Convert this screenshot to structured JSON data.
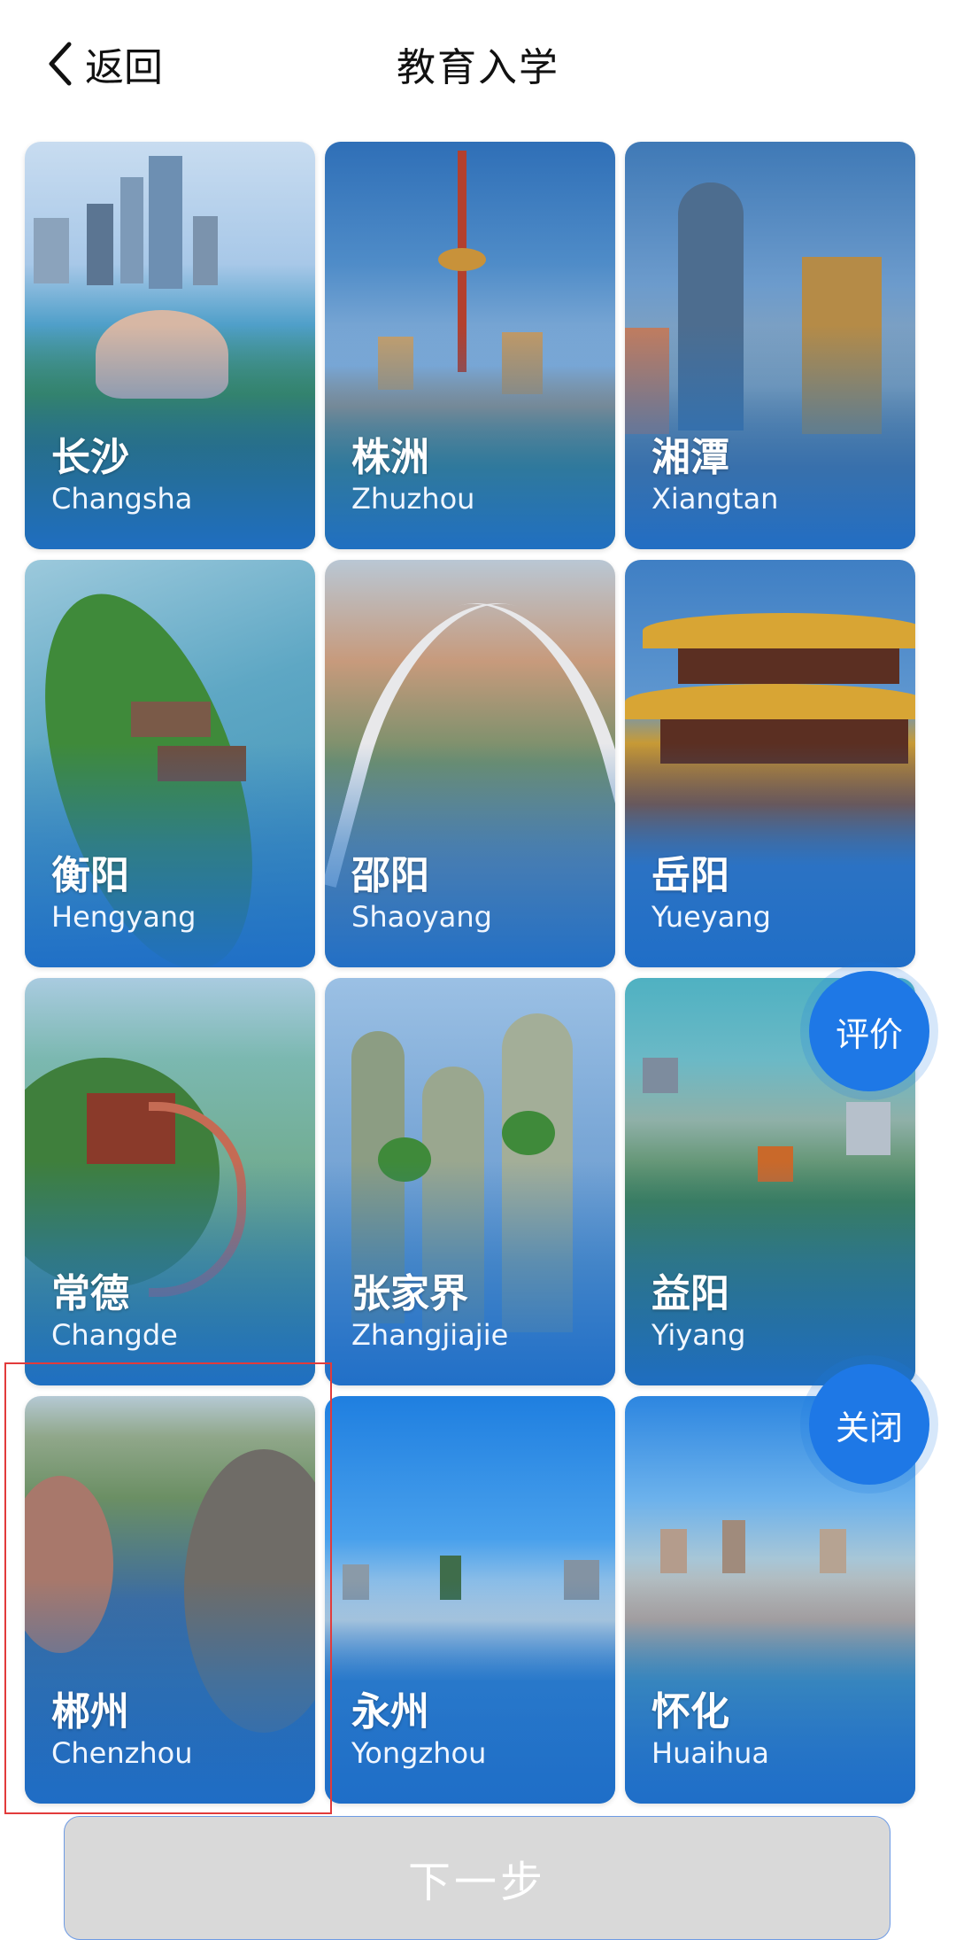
{
  "header": {
    "back_label": "返回",
    "title": "教育入学"
  },
  "cities": [
    {
      "cn": "长沙",
      "en": "Changsha"
    },
    {
      "cn": "株洲",
      "en": "Zhuzhou"
    },
    {
      "cn": "湘潭",
      "en": "Xiangtan"
    },
    {
      "cn": "衡阳",
      "en": "Hengyang"
    },
    {
      "cn": "邵阳",
      "en": "Shaoyang"
    },
    {
      "cn": "岳阳",
      "en": "Yueyang"
    },
    {
      "cn": "常德",
      "en": "Changde"
    },
    {
      "cn": "张家界",
      "en": "Zhangjiajie"
    },
    {
      "cn": "益阳",
      "en": "Yiyang"
    },
    {
      "cn": "郴州",
      "en": "Chenzhou"
    },
    {
      "cn": "永州",
      "en": "Yongzhou"
    },
    {
      "cn": "怀化",
      "en": "Huaihua"
    }
  ],
  "float_buttons": {
    "rate_label": "评价",
    "close_label": "关闭"
  },
  "footer": {
    "next_label": "下一步"
  },
  "colors": {
    "accent": "#1e78e6",
    "card_overlay": "#2a74c8",
    "selection": "#e23b3b",
    "disabled": "#d9d9d9"
  }
}
